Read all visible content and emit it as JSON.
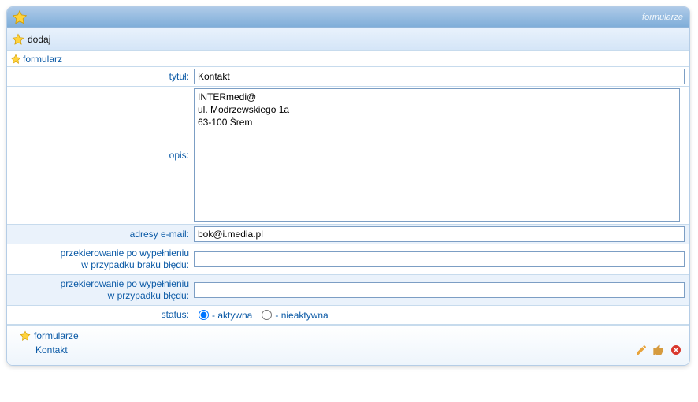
{
  "header": {
    "title": "formularze"
  },
  "toolbar": {
    "add_label": "dodaj"
  },
  "section": {
    "title": "formularz"
  },
  "fields": {
    "title": {
      "label": "tytuł:",
      "value": "Kontakt"
    },
    "desc": {
      "label": "opis:",
      "value": "INTERmedi@\nul. Modrzewskiego 1a\n63-100 Śrem"
    },
    "emails": {
      "label": "adresy e-mail:",
      "value": "bok@i.media.pl"
    },
    "redirect_ok": {
      "label_line1": "przekierowanie po wypełnieniu",
      "label_line2": "w przypadku braku błędu:",
      "value": ""
    },
    "redirect_err": {
      "label_line1": "przekierowanie po wypełnieniu",
      "label_line2": "w przypadku błędu:",
      "value": ""
    },
    "status": {
      "label": "status:",
      "active": "- aktywna",
      "inactive": "- nieaktywna",
      "selected": "active"
    }
  },
  "footer": {
    "group": "formularze",
    "item": "Kontakt"
  },
  "icons": {
    "star": "star",
    "edit": "pencil",
    "lock": "thumb",
    "delete": "close"
  }
}
